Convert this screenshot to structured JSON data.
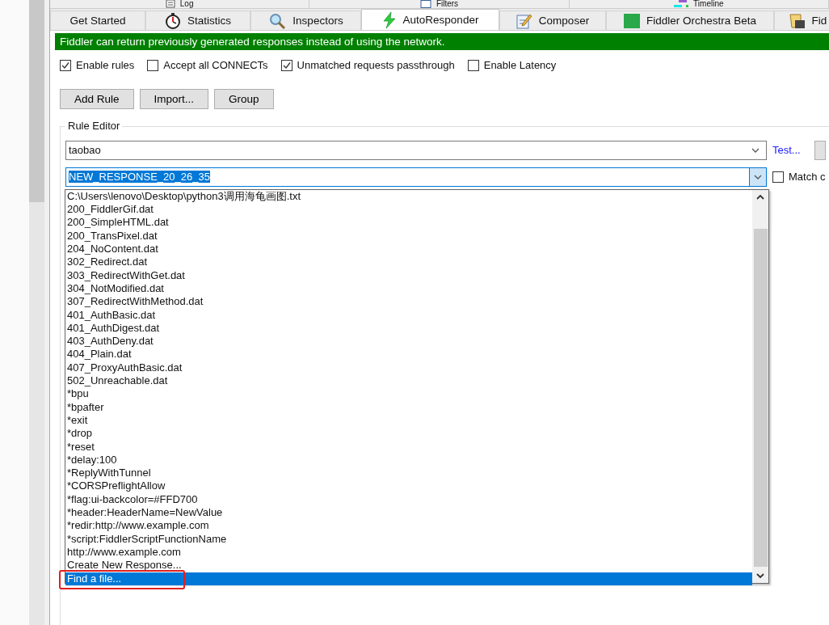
{
  "top_tabs": [
    {
      "label": "Log"
    },
    {
      "label": "Filters"
    },
    {
      "label": "Timeline"
    }
  ],
  "tabs": [
    {
      "label": "Get Started",
      "selected": false
    },
    {
      "label": "Statistics",
      "selected": false
    },
    {
      "label": "Inspectors",
      "selected": false
    },
    {
      "label": "AutoResponder",
      "selected": true
    },
    {
      "label": "Composer",
      "selected": false
    },
    {
      "label": "Fiddler Orchestra Beta",
      "selected": false
    },
    {
      "label": "Fid",
      "selected": false
    }
  ],
  "banner": "Fiddler can return previously generated responses instead of using the network.",
  "options": [
    {
      "label": "Enable rules",
      "checked": true
    },
    {
      "label": "Accept all CONNECTs",
      "checked": false
    },
    {
      "label": "Unmatched requests passthrough",
      "checked": true
    },
    {
      "label": "Enable Latency",
      "checked": false
    }
  ],
  "buttons": [
    "Add Rule",
    "Import...",
    "Group"
  ],
  "rule_editor": {
    "title": "Rule Editor",
    "match_value": "taobao",
    "test_link": "Test...",
    "action_value": "NEW_RESPONSE_20_26_35",
    "match_option": {
      "label": "Match c",
      "checked": false
    },
    "dropdown_items": [
      {
        "label": "C:\\Users\\lenovo\\Desktop\\python3调用海龟画图.txt",
        "selected": false
      },
      {
        "label": "200_FiddlerGif.dat",
        "selected": false
      },
      {
        "label": "200_SimpleHTML.dat",
        "selected": false
      },
      {
        "label": "200_TransPixel.dat",
        "selected": false
      },
      {
        "label": "204_NoContent.dat",
        "selected": false
      },
      {
        "label": "302_Redirect.dat",
        "selected": false
      },
      {
        "label": "303_RedirectWithGet.dat",
        "selected": false
      },
      {
        "label": "304_NotModified.dat",
        "selected": false
      },
      {
        "label": "307_RedirectWithMethod.dat",
        "selected": false
      },
      {
        "label": "401_AuthBasic.dat",
        "selected": false
      },
      {
        "label": "401_AuthDigest.dat",
        "selected": false
      },
      {
        "label": "403_AuthDeny.dat",
        "selected": false
      },
      {
        "label": "404_Plain.dat",
        "selected": false
      },
      {
        "label": "407_ProxyAuthBasic.dat",
        "selected": false
      },
      {
        "label": "502_Unreachable.dat",
        "selected": false
      },
      {
        "label": "*bpu",
        "selected": false
      },
      {
        "label": "*bpafter",
        "selected": false
      },
      {
        "label": "*exit",
        "selected": false
      },
      {
        "label": "*drop",
        "selected": false
      },
      {
        "label": "*reset",
        "selected": false
      },
      {
        "label": "*delay:100",
        "selected": false
      },
      {
        "label": "*ReplyWithTunnel",
        "selected": false
      },
      {
        "label": "*CORSPreflightAllow",
        "selected": false
      },
      {
        "label": "*flag:ui-backcolor=#FFD700",
        "selected": false
      },
      {
        "label": "*header:HeaderName=NewValue",
        "selected": false
      },
      {
        "label": "*redir:http://www.example.com",
        "selected": false
      },
      {
        "label": "*script:FiddlerScriptFunctionName",
        "selected": false
      },
      {
        "label": "http://www.example.com",
        "selected": false
      },
      {
        "label": "Create New Response...",
        "selected": false
      },
      {
        "label": "Find a file...",
        "selected": true
      }
    ]
  }
}
